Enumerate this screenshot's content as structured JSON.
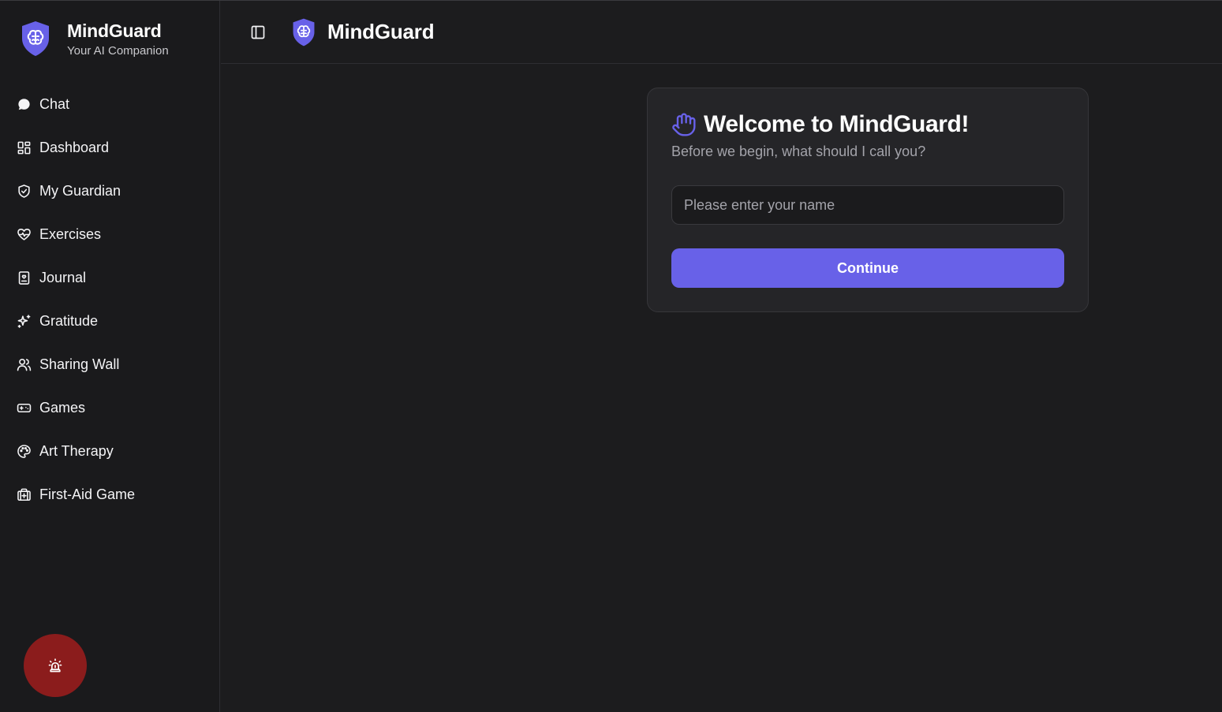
{
  "brand": {
    "title": "MindGuard",
    "subtitle": "Your AI Companion",
    "logo_icon": "brain-shield-icon",
    "accent_color": "#6861e8"
  },
  "sidebar": {
    "items": [
      {
        "label": "Chat",
        "icon": "message-circle-icon"
      },
      {
        "label": "Dashboard",
        "icon": "layout-dashboard-icon"
      },
      {
        "label": "My Guardian",
        "icon": "shield-check-icon"
      },
      {
        "label": "Exercises",
        "icon": "heart-pulse-icon"
      },
      {
        "label": "Journal",
        "icon": "notebook-icon"
      },
      {
        "label": "Gratitude",
        "icon": "sparkles-icon"
      },
      {
        "label": "Sharing Wall",
        "icon": "users-icon"
      },
      {
        "label": "Games",
        "icon": "gamepad-icon"
      },
      {
        "label": "Art Therapy",
        "icon": "palette-icon"
      },
      {
        "label": "First-Aid Game",
        "icon": "first-aid-kit-icon"
      }
    ],
    "emergency_button": {
      "icon": "siren-icon",
      "color": "#8b1c1c"
    }
  },
  "header": {
    "title": "MindGuard",
    "toggle_icon": "panel-left-icon"
  },
  "welcome_card": {
    "title": "Welcome to MindGuard!",
    "subtitle": "Before we begin, what should I call you?",
    "icon": "hand-wave-icon",
    "input": {
      "value": "",
      "placeholder": "Please enter your name"
    },
    "button_label": "Continue"
  }
}
